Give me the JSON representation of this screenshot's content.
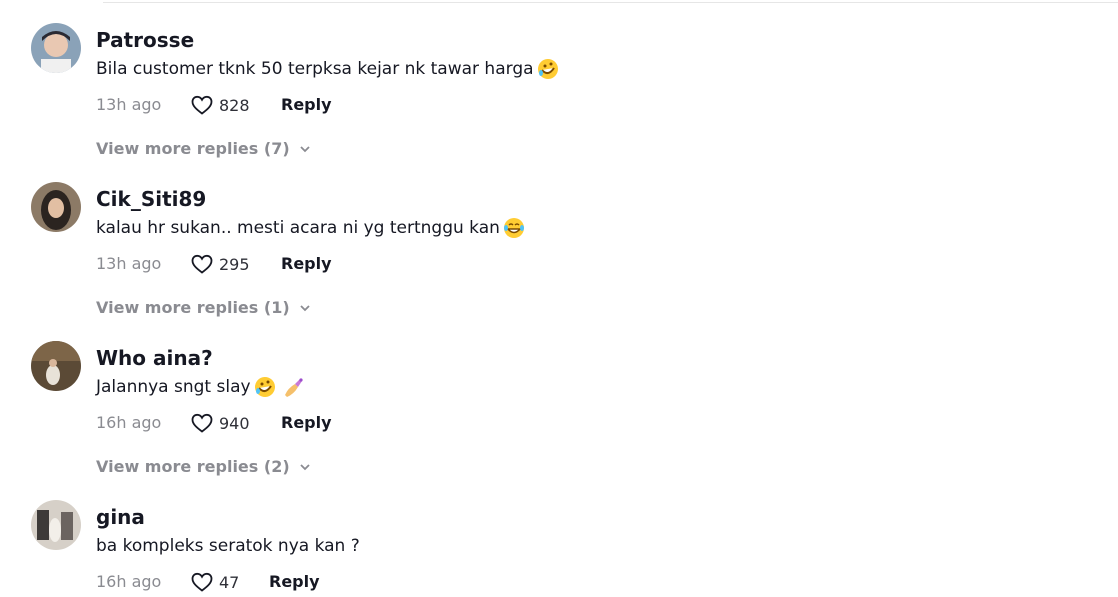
{
  "comments": [
    {
      "username": "Patrosse",
      "text": "Bila customer tknk 50 terpksa kejar nk tawar harga",
      "emoji": "rolling-on-floor-laughing-emoji",
      "time": "13h ago",
      "likes": "828",
      "reply_label": "Reply",
      "view_more": "View more replies (7)"
    },
    {
      "username": "Cik_Siti89",
      "text": "kalau hr sukan.. mesti acara ni yg tertnggu kan ",
      "emoji": "tears-of-joy-emoji",
      "time": "13h ago",
      "likes": "295",
      "reply_label": "Reply",
      "view_more": "View more replies (1)"
    },
    {
      "username": "Who aina?",
      "text": "Jalannya sngt slay",
      "emoji": "rolling-on-floor-laughing-emoji, nail-polish-emoji",
      "time": "16h ago",
      "likes": "940",
      "reply_label": "Reply",
      "view_more": "View more replies (2)"
    },
    {
      "username": "gina",
      "text": "ba kompleks seratok nya kan ?",
      "time": "16h ago",
      "likes": "47",
      "reply_label": "Reply"
    }
  ],
  "colors": {
    "text": "#161823",
    "muted": "#8a8b91"
  }
}
